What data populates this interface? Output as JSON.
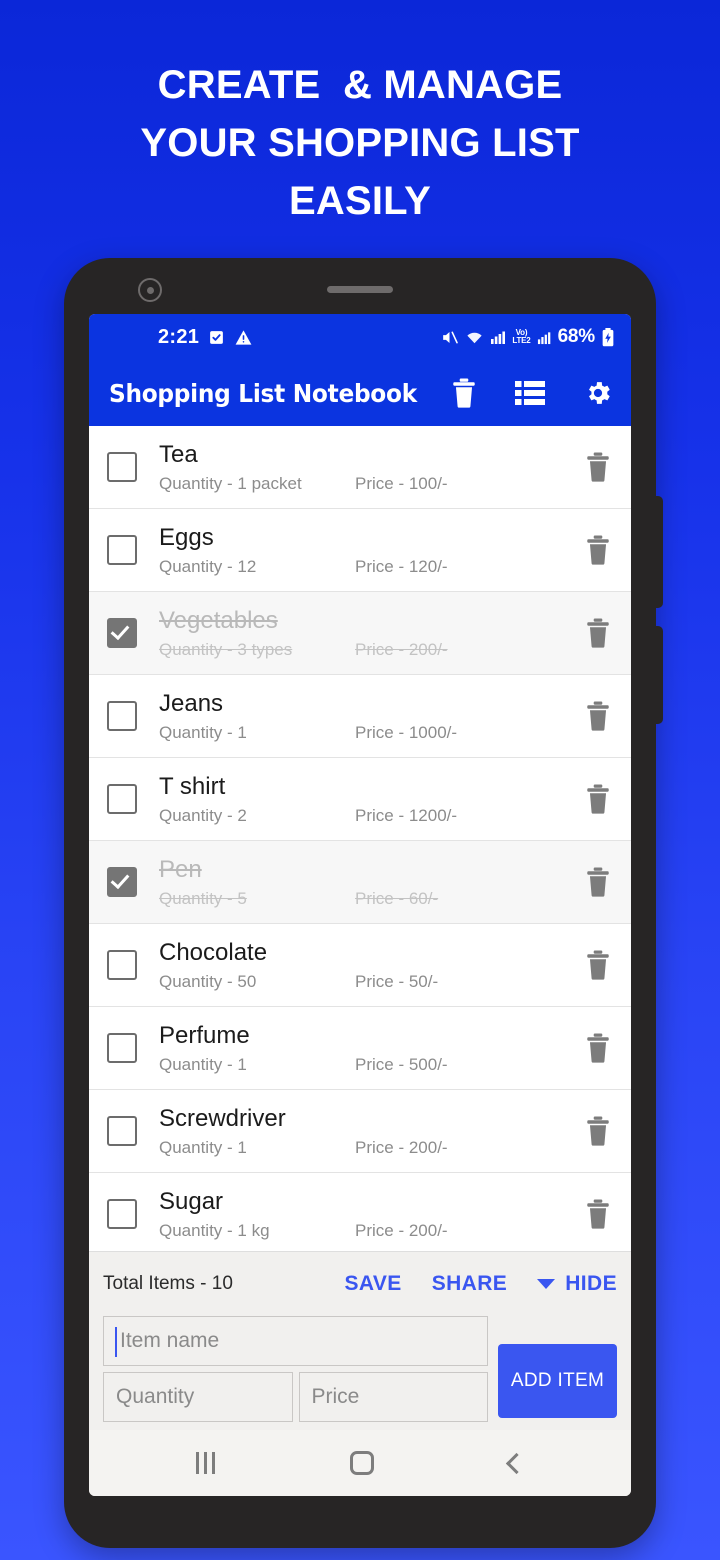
{
  "promo": {
    "headline_lines": [
      "CREATE  & MANAGE",
      "YOUR SHOPPING LIST",
      "EASILY"
    ],
    "background_top_color": "#0b27d8",
    "background_bottom_color": "#3a55ff"
  },
  "statusbar": {
    "time": "2:21",
    "battery_percent": "68%",
    "network_badge_top": "Vo)",
    "network_badge_bottom": "LTE2",
    "icons": [
      "task-checkbox-icon",
      "warning-triangle-icon",
      "mute-icon",
      "wifi-icon",
      "signal-icon",
      "volte-icon",
      "signal-icon-2",
      "battery-charging-icon"
    ]
  },
  "appbar": {
    "title": "Shopping List Notebook",
    "background_color": "#0b34e0",
    "actions": [
      {
        "name": "delete-all-button",
        "icon": "trash-icon"
      },
      {
        "name": "lists-button",
        "icon": "list-icon"
      },
      {
        "name": "settings-button",
        "icon": "gear-icon"
      }
    ]
  },
  "list": {
    "quantity_label_prefix": "Quantity - ",
    "price_label_prefix": "Price - ",
    "items": [
      {
        "name": "Tea",
        "quantity": "Quantity - 1 packet",
        "price": "Price - 100/-",
        "checked": false
      },
      {
        "name": "Eggs",
        "quantity": "Quantity - 12",
        "price": "Price - 120/-",
        "checked": false
      },
      {
        "name": "Vegetables",
        "quantity": "Quantity - 3 types",
        "price": "Price - 200/-",
        "checked": true
      },
      {
        "name": "Jeans",
        "quantity": "Quantity - 1",
        "price": "Price - 1000/-",
        "checked": false
      },
      {
        "name": "T shirt",
        "quantity": "Quantity - 2",
        "price": "Price - 1200/-",
        "checked": false
      },
      {
        "name": "Pen",
        "quantity": "Quantity - 5",
        "price": "Price - 60/-",
        "checked": true
      },
      {
        "name": "Chocolate",
        "quantity": "Quantity - 50",
        "price": "Price - 50/-",
        "checked": false
      },
      {
        "name": "Perfume",
        "quantity": "Quantity - 1",
        "price": "Price - 500/-",
        "checked": false
      },
      {
        "name": "Screwdriver",
        "quantity": "Quantity - 1",
        "price": "Price - 200/-",
        "checked": false
      },
      {
        "name": "Sugar",
        "quantity": "Quantity - 1 kg",
        "price": "Price - 200/-",
        "checked": false
      }
    ]
  },
  "bottom": {
    "total_text": "Total Items - 10",
    "save_label": "SAVE",
    "share_label": "SHARE",
    "hide_label": "HIDE",
    "accent_color": "#3a56f0",
    "item_name_placeholder": "Item name",
    "item_name_value": "",
    "quantity_placeholder": "Quantity",
    "quantity_value": "",
    "price_placeholder": "Price",
    "price_value": "",
    "add_item_label": "ADD ITEM"
  },
  "navbar": {
    "recents": "recents-icon",
    "home": "home-icon",
    "back": "back-icon"
  }
}
